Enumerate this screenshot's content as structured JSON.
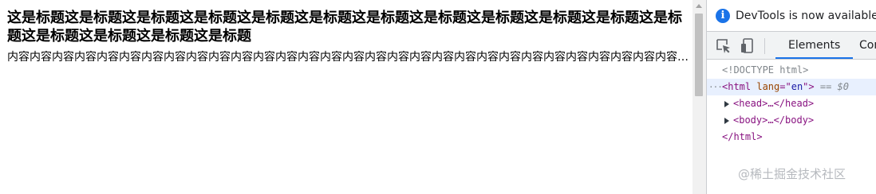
{
  "page": {
    "title": "这是标题这是标题这是标题这是标题这是标题这是标题这是标题这是标题这是标题这是标题这是标题这是标题这是标题这是标题这是标题这是标题",
    "body": "内容内容内容内容内容内容内容内容内容内容内容内容内容内容内容内容内容内容内容内容内容内容内容内容内容内容内容内容内容内容内容内容"
  },
  "devtools": {
    "banner_text": "DevTools is now available in",
    "tabs": [
      {
        "label": "Elements",
        "active": true
      },
      {
        "label": "Con",
        "active": false
      }
    ],
    "dom": {
      "doctype": "<!DOCTYPE html>",
      "html_open_tag": "<html",
      "html_attr_name": "lang",
      "html_attr_eq": "=\"",
      "html_attr_value": "en",
      "html_attr_close": "\">",
      "selection_marker": "== $0",
      "head_line": "<head>…</head>",
      "body_line": "<body>…</body>",
      "html_close": "</html>",
      "dots": "···"
    }
  },
  "watermark": "@稀土掘金技术社区",
  "icons": {
    "info": "info-icon",
    "inspect": "inspect-element-icon",
    "device": "device-toolbar-icon"
  },
  "colors": {
    "accent": "#1a73e8",
    "tag": "#881280",
    "attr_name": "#994500",
    "attr_value": "#1a1aa6",
    "selected_row": "#e8f0fe"
  }
}
